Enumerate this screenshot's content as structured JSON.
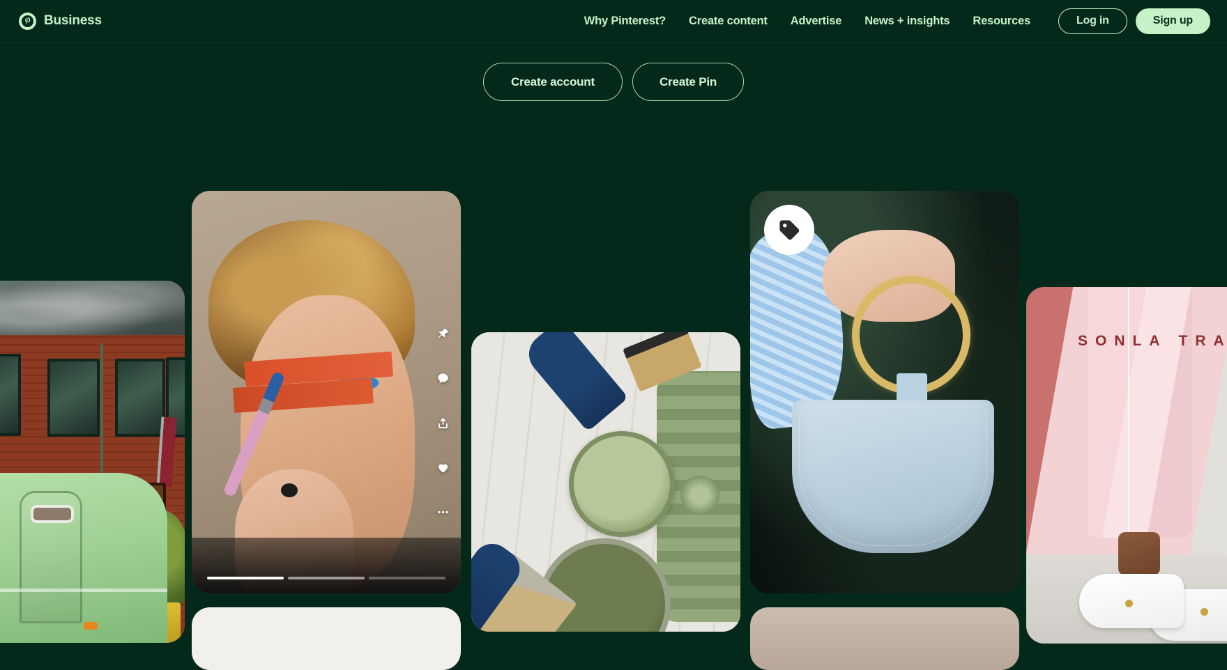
{
  "theme": {
    "background": "#04291b",
    "accent_mint": "#c5f2c7",
    "header_border": "#0d3a27",
    "cta_border": "#9fdca8"
  },
  "header": {
    "brand": {
      "logo_icon": "pinterest-p-icon",
      "label": "Business"
    },
    "nav": [
      {
        "label": "Why Pinterest?"
      },
      {
        "label": "Create content"
      },
      {
        "label": "Advertise"
      },
      {
        "label": "News + insights"
      },
      {
        "label": "Resources"
      }
    ],
    "auth": {
      "login_label": "Log in",
      "signup_label": "Sign up"
    }
  },
  "cta": {
    "create_account_label": "Create account",
    "create_pin_label": "Create Pin"
  },
  "pins": {
    "trailer": {
      "alt": "Mint green vintage trailer parked in front of a red brick house"
    },
    "makeup": {
      "alt": "Person with curly blond hair applying blue eye makeup with orange tape on face",
      "is_video": true,
      "actions": [
        {
          "icon": "pin-save-icon",
          "label": "Save"
        },
        {
          "icon": "comment-bubble-icon",
          "label": "Comment"
        },
        {
          "icon": "share-upload-icon",
          "label": "Share"
        },
        {
          "icon": "heart-icon",
          "label": "React"
        },
        {
          "icon": "more-dots-icon",
          "label": "More options"
        }
      ],
      "story_segments": [
        {
          "state": "on"
        },
        {
          "state": "dim"
        },
        {
          "state": "off"
        }
      ]
    },
    "paint": {
      "alt": "Blue handled paint brushes and sage green paint cans on whitewashed wood"
    },
    "handbag": {
      "alt": "Hand holding a light blue leather handbag with a gold ring handle",
      "badge_icon": "price-tag-icon",
      "badge_label": "Shoppable Pin"
    },
    "fashion": {
      "alt": "Pink trousers and white sneakers against a pink wall",
      "overlay_text": "SONLA TRA"
    },
    "peek_light": {
      "alt": "Partially visible light colored Pin below"
    },
    "peek_tan": {
      "alt": "Partially visible tan colored Pin below"
    }
  }
}
